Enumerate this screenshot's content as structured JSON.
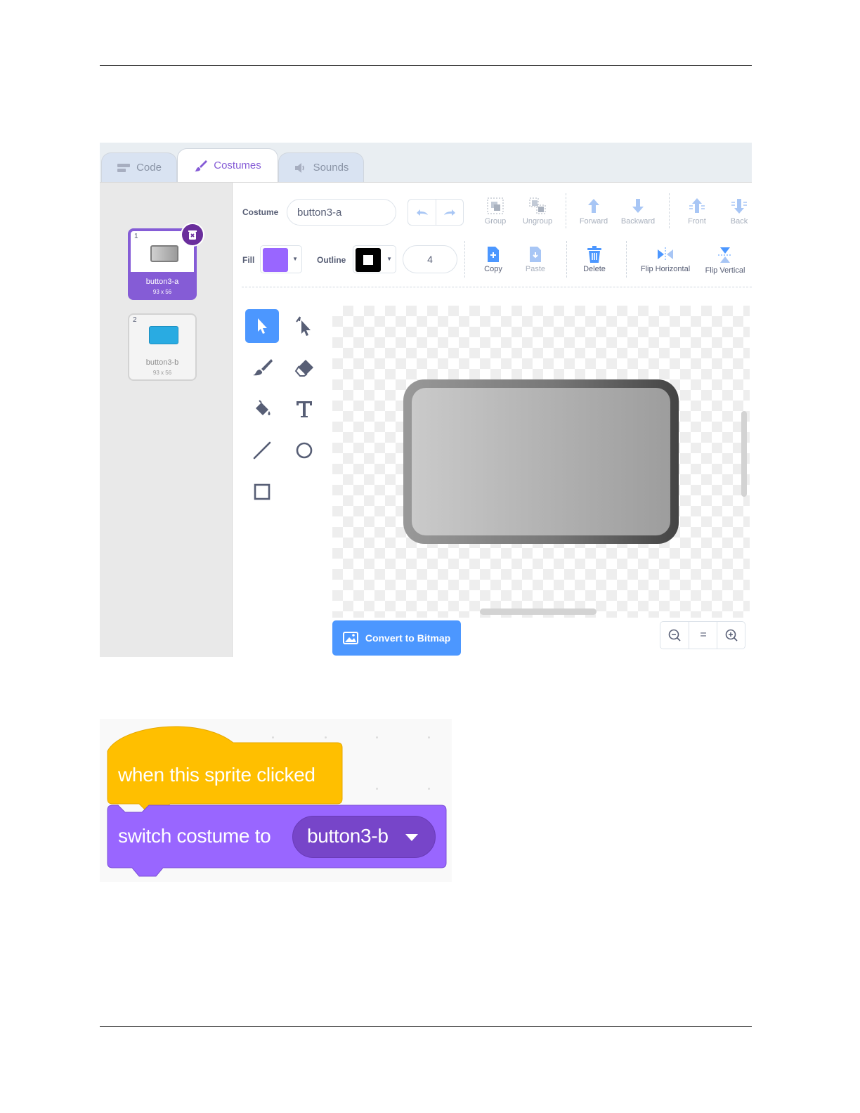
{
  "tabs": [
    {
      "label": "Code",
      "icon": "code-icon"
    },
    {
      "label": "Costumes",
      "icon": "paintbrush-icon",
      "active": true
    },
    {
      "label": "Sounds",
      "icon": "speaker-icon"
    }
  ],
  "costumes": [
    {
      "number": "1",
      "name": "button3-a",
      "size": "93 x 56",
      "selected": true
    },
    {
      "number": "2",
      "name": "button3-b",
      "size": "93 x 56",
      "selected": false
    }
  ],
  "editor": {
    "costume_label": "Costume",
    "costume_name": "button3-a",
    "fill_label": "Fill",
    "fill_color": "#9966ff",
    "outline_label": "Outline",
    "outline_color": "#000000",
    "outline_width": "4",
    "tools_top": [
      "Group",
      "Ungroup",
      "Forward",
      "Backward",
      "Front",
      "Back"
    ],
    "tools_bottom": [
      "Copy",
      "Paste",
      "Delete",
      "Flip Horizontal",
      "Flip Vertical"
    ],
    "convert_label": "Convert to Bitmap",
    "zoom_reset_label": "="
  },
  "blocks": {
    "hat_text": "when this sprite clicked",
    "hat_color": "#ffbf00",
    "looks_text": "switch costume to",
    "looks_color": "#9966ff",
    "dropdown_value": "button3-b"
  },
  "colors": {
    "accent": "#855cd6",
    "primary_blue": "#4c97ff"
  }
}
